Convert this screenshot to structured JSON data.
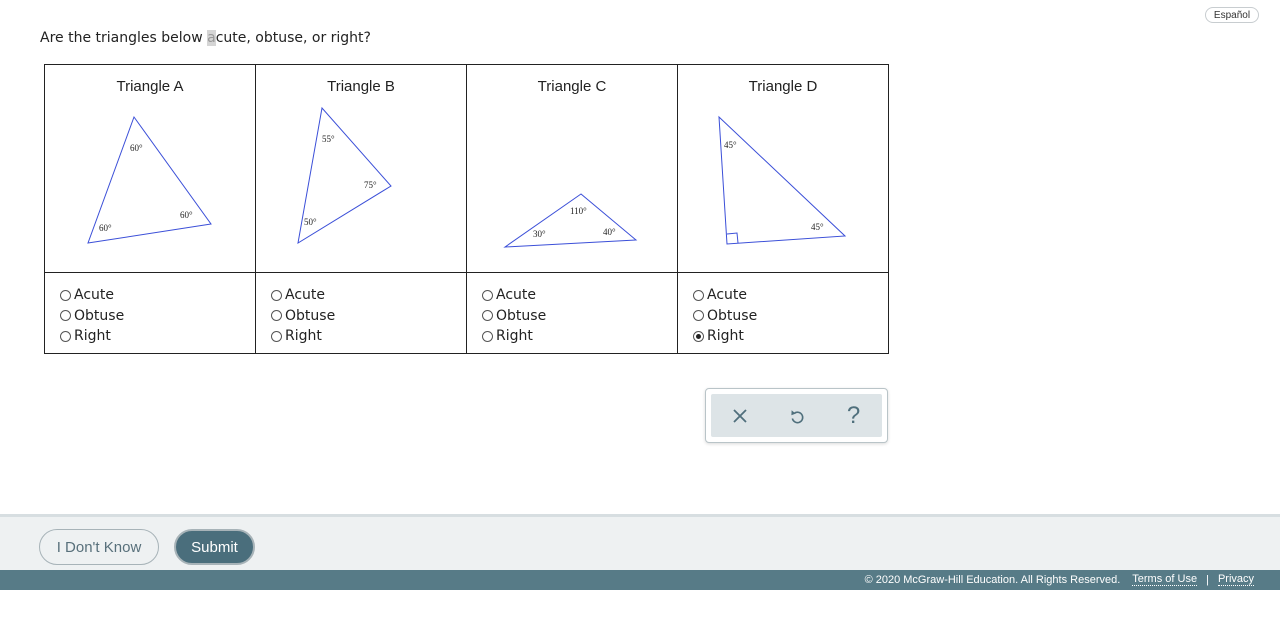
{
  "header": {
    "language_button": "Español"
  },
  "question": {
    "before": "Are the triangles below ",
    "highlighted": "a",
    "after": "cute, obtuse, or right?"
  },
  "triangles": [
    {
      "title": "Triangle A",
      "angles": [
        "60°",
        "60°",
        "60°"
      ]
    },
    {
      "title": "Triangle B",
      "angles": [
        "55°",
        "75°",
        "50°"
      ]
    },
    {
      "title": "Triangle C",
      "angles": [
        "110°",
        "30°",
        "40°"
      ]
    },
    {
      "title": "Triangle D",
      "angles": [
        "45°",
        "45°"
      ]
    }
  ],
  "options": [
    "Acute",
    "Obtuse",
    "Right"
  ],
  "selected": {
    "triangle_a": null,
    "triangle_b": null,
    "triangle_c": null,
    "triangle_d": "Right"
  },
  "toolbox": {
    "icons": [
      "close-icon",
      "undo-icon",
      "help-icon"
    ],
    "help_glyph": "?"
  },
  "actions": {
    "dont_know": "I Don't Know",
    "submit": "Submit"
  },
  "footer": {
    "copyright": "© 2020 McGraw-Hill Education. All Rights Reserved.",
    "terms": "Terms of Use",
    "separator": "|",
    "privacy": "Privacy"
  },
  "colors": {
    "triangle_stroke": "#3b4fd8",
    "footer_bg": "#577b87",
    "submit_bg": "#4a6e7c",
    "tool_icon": "#4f6f7c"
  }
}
